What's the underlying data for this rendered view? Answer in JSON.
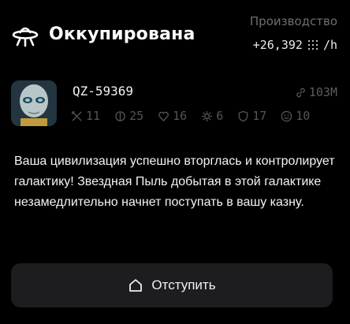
{
  "header": {
    "title": "Оккупирована",
    "title_icon": "ufo-icon",
    "production_label": "Производство",
    "production_value": "+26,392",
    "production_icon": "stardust-icon",
    "production_unit": "/h"
  },
  "profile": {
    "name": "QZ-59369",
    "avatar": "alien-avatar",
    "power_icon": "link-icon",
    "power_value": "103M",
    "stats": [
      {
        "icon": "crossed-swords-icon",
        "value": "11"
      },
      {
        "icon": "shield-icon",
        "value": "25"
      },
      {
        "icon": "heart-icon",
        "value": "16"
      },
      {
        "icon": "gear-icon",
        "value": "6"
      },
      {
        "icon": "shield-outline-icon",
        "value": "17"
      },
      {
        "icon": "smile-icon",
        "value": "10"
      }
    ]
  },
  "description": "Ваша цивилизация успешно вторглась и контролирует галактику! Звездная Пыль добытая в этой галактике незамедлительно начнет поступать в вашу казну.",
  "action": {
    "label": "Отступить",
    "icon": "home-icon"
  }
}
